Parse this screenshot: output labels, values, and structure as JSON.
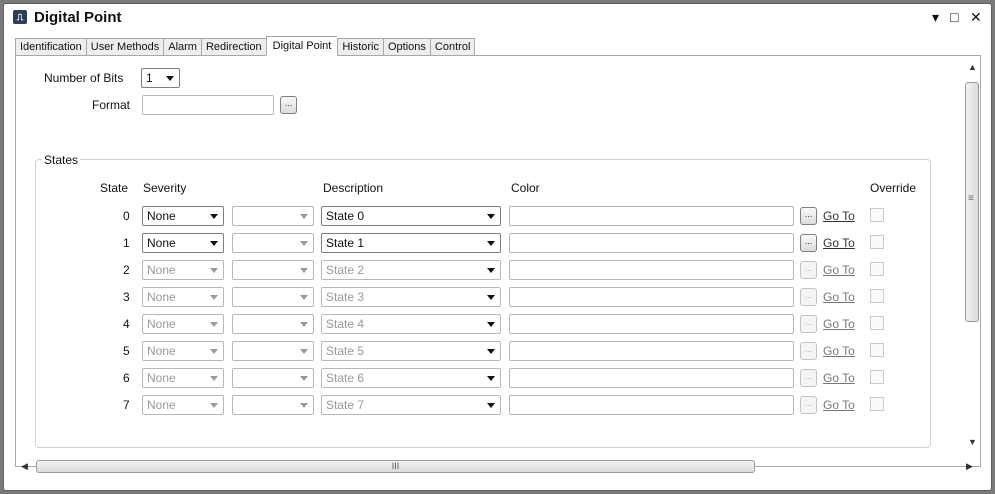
{
  "window": {
    "title": "Digital Point",
    "app_icon": "digital-signal-icon",
    "controls": {
      "menu": "▾",
      "maximize": "□",
      "close": "✕"
    }
  },
  "tabs": [
    {
      "label": "Identification",
      "active": false
    },
    {
      "label": "User Methods",
      "active": false
    },
    {
      "label": "Alarm",
      "active": false
    },
    {
      "label": "Redirection",
      "active": false
    },
    {
      "label": "Digital Point",
      "active": true
    },
    {
      "label": "Historic",
      "active": false
    },
    {
      "label": "Options",
      "active": false
    },
    {
      "label": "Control",
      "active": false
    }
  ],
  "form": {
    "bits_label": "Number of Bits",
    "bits_value": "1",
    "format_label": "Format",
    "format_value": "",
    "ellipsis": "..."
  },
  "states": {
    "legend": "States",
    "headers": {
      "state": "State",
      "severity": "Severity",
      "description": "Description",
      "color": "Color",
      "override": "Override"
    },
    "goto_label": "Go To",
    "rows": [
      {
        "state": "0",
        "severity": "None",
        "description": "State 0",
        "enabled": true
      },
      {
        "state": "1",
        "severity": "None",
        "description": "State 1",
        "enabled": true
      },
      {
        "state": "2",
        "severity": "None",
        "description": "State 2",
        "enabled": false
      },
      {
        "state": "3",
        "severity": "None",
        "description": "State 3",
        "enabled": false
      },
      {
        "state": "4",
        "severity": "None",
        "description": "State 4",
        "enabled": false
      },
      {
        "state": "5",
        "severity": "None",
        "description": "State 5",
        "enabled": false
      },
      {
        "state": "6",
        "severity": "None",
        "description": "State 6",
        "enabled": false
      },
      {
        "state": "7",
        "severity": "None",
        "description": "State 7",
        "enabled": false
      }
    ]
  },
  "scrollbar": {
    "hgrip": "III",
    "vgrip": "≡"
  }
}
